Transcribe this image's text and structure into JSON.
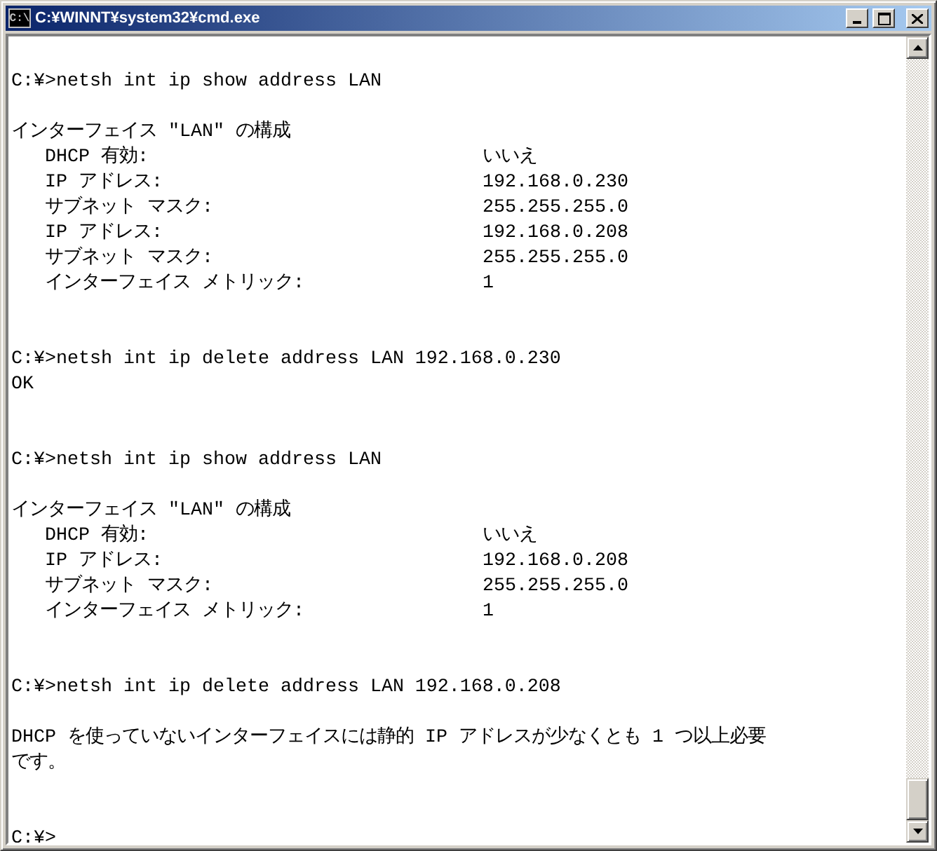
{
  "window": {
    "title": "C:¥WINNT¥system32¥cmd.exe",
    "icon_text": "C:\\"
  },
  "console": {
    "lines": [
      {
        "kind": "blank"
      },
      {
        "kind": "text",
        "text": "C:¥>netsh int ip show address LAN"
      },
      {
        "kind": "blank"
      },
      {
        "kind": "text",
        "text": "インターフェイス \"LAN\" の構成"
      },
      {
        "kind": "field",
        "label": "DHCP 有効:",
        "value": "いいえ"
      },
      {
        "kind": "field",
        "label": "IP アドレス:",
        "value": "192.168.0.230"
      },
      {
        "kind": "field",
        "label": "サブネット マスク:",
        "value": "255.255.255.0"
      },
      {
        "kind": "field",
        "label": "IP アドレス:",
        "value": "192.168.0.208"
      },
      {
        "kind": "field",
        "label": "サブネット マスク:",
        "value": "255.255.255.0"
      },
      {
        "kind": "field",
        "label": "インターフェイス メトリック:",
        "value": "1"
      },
      {
        "kind": "blank"
      },
      {
        "kind": "blank"
      },
      {
        "kind": "text",
        "text": "C:¥>netsh int ip delete address LAN 192.168.0.230"
      },
      {
        "kind": "text",
        "text": "OK"
      },
      {
        "kind": "blank"
      },
      {
        "kind": "blank"
      },
      {
        "kind": "text",
        "text": "C:¥>netsh int ip show address LAN"
      },
      {
        "kind": "blank"
      },
      {
        "kind": "text",
        "text": "インターフェイス \"LAN\" の構成"
      },
      {
        "kind": "field",
        "label": "DHCP 有効:",
        "value": "いいえ"
      },
      {
        "kind": "field",
        "label": "IP アドレス:",
        "value": "192.168.0.208"
      },
      {
        "kind": "field",
        "label": "サブネット マスク:",
        "value": "255.255.255.0"
      },
      {
        "kind": "field",
        "label": "インターフェイス メトリック:",
        "value": "1"
      },
      {
        "kind": "blank"
      },
      {
        "kind": "blank"
      },
      {
        "kind": "text",
        "text": "C:¥>netsh int ip delete address LAN 192.168.0.208"
      },
      {
        "kind": "blank"
      },
      {
        "kind": "text",
        "text": "DHCP を使っていないインターフェイスには静的 IP アドレスが少なくとも 1 つ以上必要です。"
      },
      {
        "kind": "blank"
      },
      {
        "kind": "blank"
      },
      {
        "kind": "text",
        "text": "C:¥>"
      }
    ]
  }
}
